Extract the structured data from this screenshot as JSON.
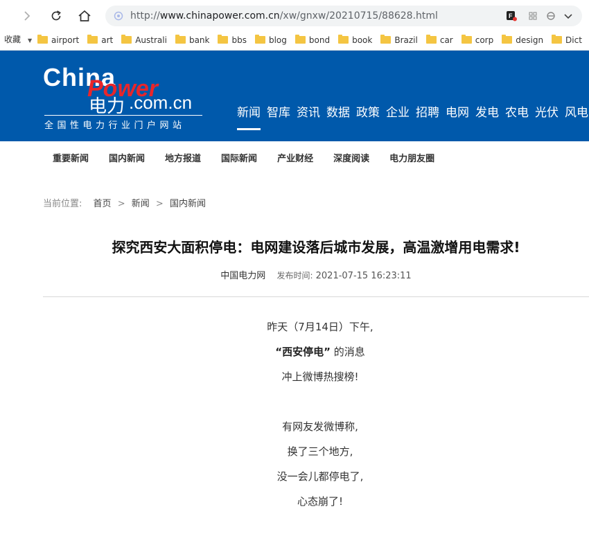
{
  "browser": {
    "url_prefix": "http://",
    "url_host": "www.chinapower.com.cn",
    "url_path": "/xw/gnxw/20210715/88628.html"
  },
  "bookmarks": {
    "favorites_label": "收藏",
    "items": [
      "airport",
      "art",
      "Australi",
      "bank",
      "bbs",
      "blog",
      "bond",
      "book",
      "Brazil",
      "car",
      "corp",
      "design",
      "Dict"
    ]
  },
  "site": {
    "logo_china": "China",
    "logo_power": "Power",
    "logo_dianli": "电力",
    "logo_domain": ".com.cn",
    "tagline": "全国性电力行业门户网站"
  },
  "main_nav": {
    "items": [
      "新闻",
      "智库",
      "资讯",
      "数据",
      "政策",
      "企业",
      "招聘",
      "电网",
      "发电",
      "农电",
      "光伏",
      "风电"
    ]
  },
  "sub_nav": {
    "items": [
      "重要新闻",
      "国内新闻",
      "地方报道",
      "国际新闻",
      "产业财经",
      "深度阅读",
      "电力朋友圈"
    ]
  },
  "breadcrumb": {
    "label": "当前位置:",
    "home": "首页",
    "sep": ">",
    "section": "新闻",
    "current": "国内新闻"
  },
  "article": {
    "title": "探究西安大面积停电：电网建设落后城市发展，高温激增用电需求!",
    "source": "中国电力网",
    "time_label": "发布时间:",
    "time": "2021-07-15 16:23:11",
    "p1": "昨天（7月14日）下午,",
    "p2_bold": "“西安停电”",
    "p2_rest": "的消息",
    "p3": "冲上微博热搜榜!",
    "p4": "有网友发微博称,",
    "p5": "换了三个地方,",
    "p6": "没一会儿都停电了,",
    "p7": "心态崩了!"
  },
  "colors": {
    "header_blue": "#0059ab",
    "logo_red": "#e8262b",
    "folder_yellow": "#f4c542"
  }
}
